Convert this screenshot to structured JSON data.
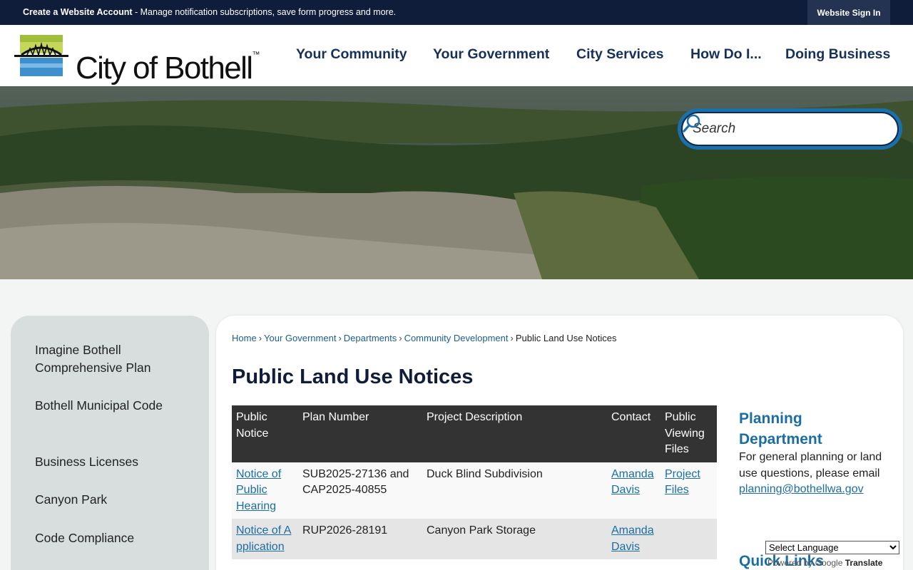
{
  "topbar": {
    "create_account": "Create a Website Account",
    "message": " - Manage notification subscriptions, save form progress and more.",
    "sign_in": "Website Sign In"
  },
  "logo": {
    "text": "City of Bothell",
    "tm": "™"
  },
  "nav": {
    "items": [
      "Your Community",
      "Your Government",
      "City Services",
      "How Do I...",
      "Doing Business"
    ]
  },
  "search": {
    "placeholder": "Search"
  },
  "sidebar": {
    "items": [
      "Imagine Bothell Comprehensive Plan",
      "Bothell Municipal Code",
      "Business Licenses",
      "Canyon Park",
      "Code Compliance"
    ]
  },
  "breadcrumb": [
    "Home",
    "Your Government",
    "Departments",
    "Community Development",
    "Public Land Use Notices"
  ],
  "page_title": "Public Land Use Notices",
  "table": {
    "headers": [
      "Public Notice",
      "Plan Number",
      "Project Description",
      "Contact",
      "Public Viewing Files"
    ],
    "rows": [
      {
        "notice": "Notice of Public Hearing",
        "plan": "SUB2025-27136 and CAP2025-40855",
        "description": "Duck Blind Subdivision",
        "contact": "Amanda Davis",
        "files": "Project Files"
      },
      {
        "notice": "Notice of Application",
        "plan": "RUP2026-28191",
        "description": "Canyon Park Storage",
        "contact": "Amanda Davis",
        "files": ""
      }
    ]
  },
  "planning": {
    "title": "Planning Department",
    "body": "For general planning or land use questions, please email",
    "email": "planning@bothellwa.gov"
  },
  "quick_links": {
    "title": "Quick Links"
  },
  "translate": {
    "select_label": "Select Language",
    "powered": "Powered by Google",
    "translate": "Translate"
  },
  "colors": {
    "navy": "#0f1c3a",
    "link": "#1a6ea3",
    "nav": "#17305a",
    "search_ring": "#1c6fa8"
  }
}
